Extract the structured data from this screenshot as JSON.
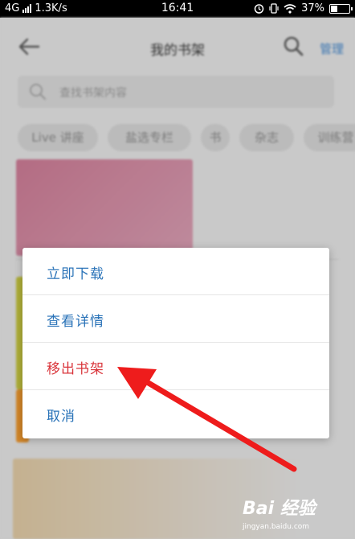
{
  "status_bar": {
    "network": "4G",
    "speed": "1.3K/s",
    "time": "16:41",
    "battery": "37%",
    "battery_level": 0.37
  },
  "header": {
    "back_icon": "back-arrow-icon",
    "title": "我的书架",
    "search_icon": "search-icon",
    "manage_label": "管理"
  },
  "search": {
    "placeholder": "查找书架内容"
  },
  "filter_chips": [
    "Live 讲座",
    "盐选专栏",
    "书",
    "杂志",
    "训练营"
  ],
  "context_menu": {
    "items": [
      {
        "label": "立即下载"
      },
      {
        "label": "查看详情"
      },
      {
        "label": "移出书架"
      },
      {
        "label": "取消"
      }
    ]
  },
  "colors": {
    "accent": "#2a73b8",
    "danger": "#d9343a",
    "annotation_arrow": "#ee1c1c"
  },
  "watermark": {
    "logo": "Bai 经验",
    "url": "jingyan.baidu.com"
  }
}
